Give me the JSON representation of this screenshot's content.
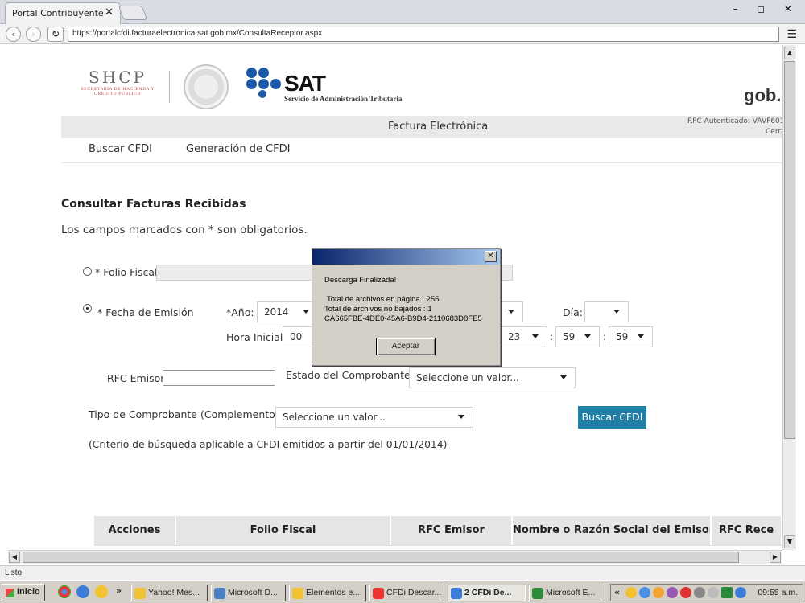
{
  "browser": {
    "tab_title": "Portal Contribuyente",
    "tab_close": "✕",
    "window_controls": "– ◻ ✕",
    "url": "https://portalcfdi.facturaelectronica.sat.gob.mx/ConsultaReceptor.aspx",
    "status": "Listo"
  },
  "header": {
    "shcp": "SHCP",
    "shcp_sub": "SECRETARÍA DE HACIENDA Y CRÉDITO PÚBLICO",
    "sat": "SAT",
    "sat_sub": "Servicio de Administración Tributaria",
    "gob": "gob.m",
    "bar_title": "Factura Electrónica",
    "rfc_auth": "RFC Autenticado: VAVF601",
    "cerrar": "Cerra"
  },
  "nav": {
    "buscar": "Buscar CFDI",
    "generacion": "Generación de CFDI"
  },
  "form": {
    "title": "Consultar Facturas Recibidas",
    "note": "Los campos marcados con * son obligatorios.",
    "folio_label": "* Folio Fiscal",
    "fecha_label": "* Fecha de Emisión",
    "anio_label": "*Año:",
    "anio_value": "2014",
    "dia_label": "Día:",
    "dia_value": "",
    "hora_label": "Hora Inicial:",
    "hora_inicial_value": "00",
    "hora_final_h": "23",
    "hora_final_m": "59",
    "hora_final_s": "59",
    "colon": ":",
    "rfc_emisor_label": "RFC Emisor",
    "estado_label": "Estado del Comprobante",
    "estado_value": "Seleccione un valor...",
    "tipo_label": "Tipo de Comprobante (Complemento)",
    "tipo_value": "Seleccione un valor...",
    "buscar_btn": "Buscar CFDI",
    "criterio": "(Criterio de búsqueda aplicable a CFDI emitidos a partir del 01/01/2014)"
  },
  "table": {
    "headers": [
      "Acciones",
      "Folio Fiscal",
      "RFC Emisor",
      "Nombre o Razón Social del Emisor",
      "RFC Rece"
    ]
  },
  "dialog": {
    "close": "✕",
    "message": "Descarga Finalizada!",
    "line1": "Total de archivos en página : 255",
    "line2": "Total de archivos no bajados : 1",
    "line3": "CA665FBE-4DE0-45A6-B9D4-2110683D8FE5",
    "accept": "Aceptar"
  },
  "taskbar": {
    "start": "Inicio",
    "more": "»",
    "tasks": [
      "Yahoo! Mes...",
      "Microsoft D...",
      "Elementos e...",
      "CFDi Descar...",
      "2 CFDi De...",
      "Microsoft E..."
    ],
    "tray_more": "«",
    "clock": "09:55 a.m."
  },
  "colors": {
    "sat_blue": "#1b58a8",
    "button_blue": "#1f7fa7",
    "dialog_title_start": "#0a246a"
  }
}
